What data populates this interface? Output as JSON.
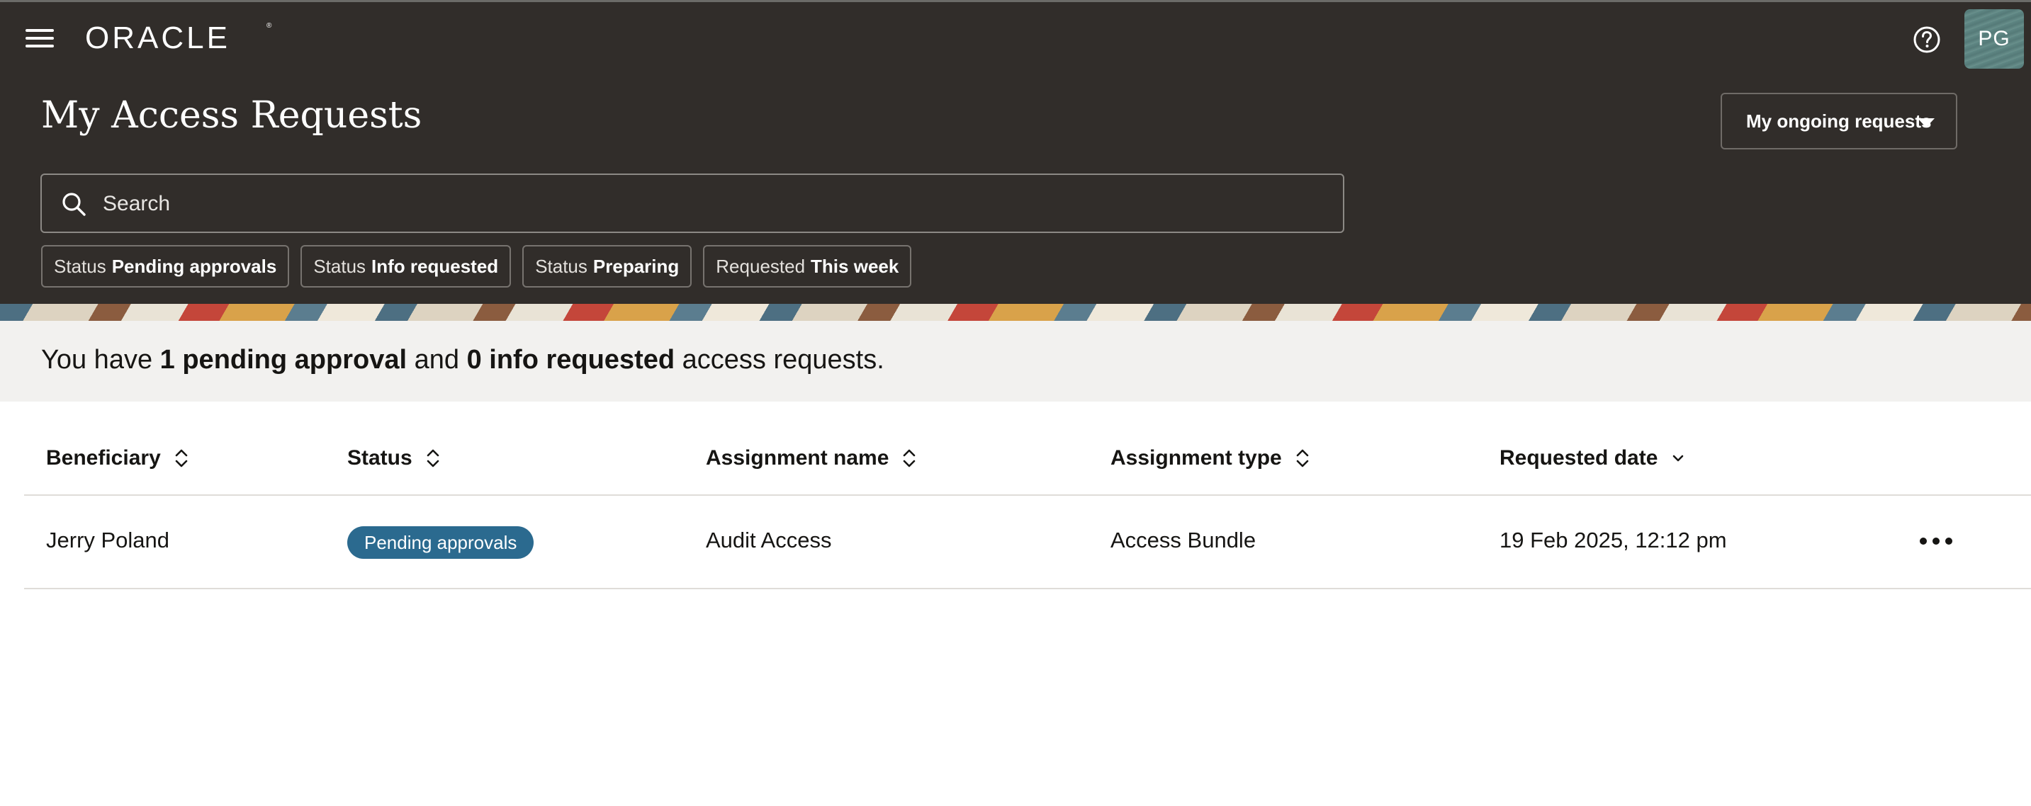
{
  "header": {
    "brand": "ORACLE",
    "page_title": "My Access Requests",
    "avatar_initials": "PG",
    "request_filter": "My ongoing requests",
    "search_placeholder": "Search",
    "filter_chips": [
      {
        "key": "Status",
        "value": "Pending approvals"
      },
      {
        "key": "Status",
        "value": "Info requested"
      },
      {
        "key": "Status",
        "value": "Preparing"
      },
      {
        "key": "Requested",
        "value": "This week"
      }
    ]
  },
  "summary": {
    "prefix": "You have",
    "pending_count_text": "1 pending approval",
    "middle": "and",
    "info_count_text": "0 info requested",
    "suffix": "access requests."
  },
  "table": {
    "columns": [
      {
        "label": "Beneficiary",
        "sort": "unsorted"
      },
      {
        "label": "Status",
        "sort": "unsorted"
      },
      {
        "label": "Assignment name",
        "sort": "unsorted"
      },
      {
        "label": "Assignment type",
        "sort": "unsorted"
      },
      {
        "label": "Requested date",
        "sort": "descending"
      }
    ],
    "rows": [
      {
        "beneficiary": "Jerry Poland",
        "status": "Pending approvals",
        "assignment_name": "Audit Access",
        "assignment_type": "Access Bundle",
        "requested_date": "19 Feb 2025, 12:12 pm"
      }
    ]
  },
  "icons": [
    "menu-icon",
    "help-icon",
    "search-icon",
    "sort-icon",
    "chevron-down-icon",
    "more-actions-icon"
  ],
  "colors": {
    "header_bg": "#312d2a",
    "summary_bg": "#f2f1ef",
    "status_badge": "#2b6a8f",
    "text": "#161513"
  }
}
